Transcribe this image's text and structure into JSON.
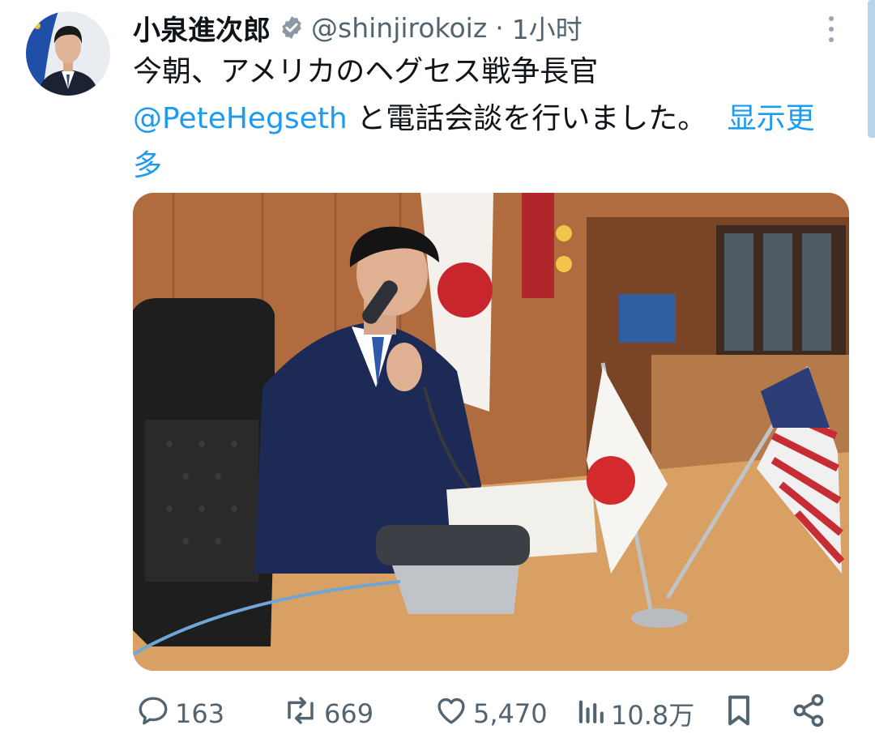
{
  "tweet": {
    "author_name": "小泉進次郎",
    "handle": "@shinjirokoiz",
    "separator": "·",
    "time": "1小时",
    "text_line1": "今朝、アメリカのヘグセス戦争長官",
    "mention": "@PeteHegseth",
    "text_rest": " と電話会談を行いました。",
    "show_more": "显示更多",
    "icons": {
      "verified": "verified-badge-icon",
      "more": "more-options-icon",
      "reply": "reply-icon",
      "retweet": "retweet-icon",
      "like": "like-icon",
      "views": "views-icon",
      "bookmark": "bookmark-icon",
      "share": "share-icon"
    }
  },
  "actions": {
    "replies": "163",
    "retweets": "669",
    "likes": "5,470",
    "views": "10.8万"
  },
  "colors": {
    "link": "#1d9bf0",
    "secondary_text": "#536471",
    "primary_text": "#0f1419"
  }
}
